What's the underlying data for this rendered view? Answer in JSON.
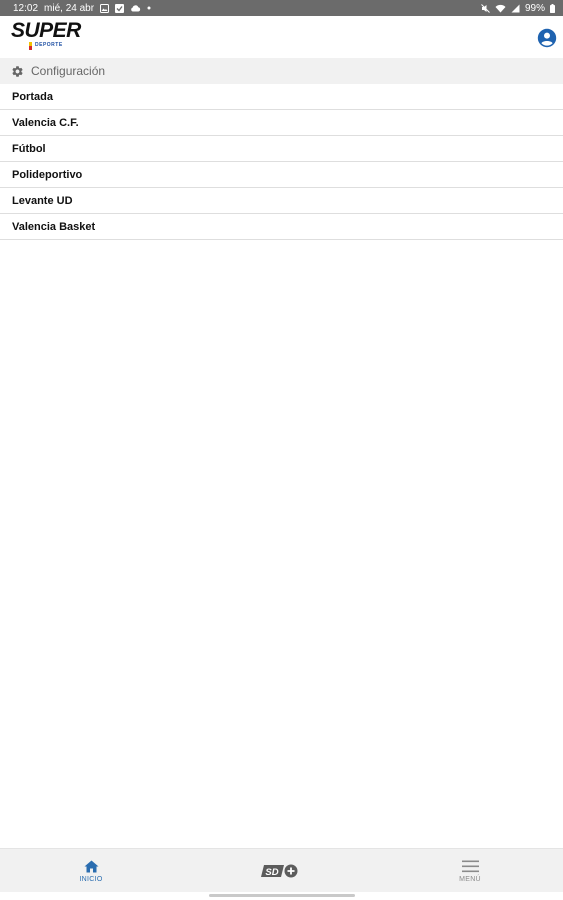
{
  "status_bar": {
    "time": "12:02",
    "date": "mié, 24 abr",
    "battery": "99%"
  },
  "header": {
    "logo_text": "SUPER",
    "logo_subtext": "DEPORTE",
    "account_icon": "account-circle-icon"
  },
  "config": {
    "label": "Configuración",
    "icon": "gear-icon"
  },
  "sections": [
    {
      "label": "Portada"
    },
    {
      "label": "Valencia C.F."
    },
    {
      "label": "Fútbol"
    },
    {
      "label": "Polideportivo"
    },
    {
      "label": "Levante UD"
    },
    {
      "label": "Valencia Basket"
    }
  ],
  "bottom_nav": {
    "home_label": "INICIO",
    "sd_label": "SD+",
    "menu_label": "MENÚ",
    "active_color": "#2a6db0",
    "inactive_color": "#8a8a8a"
  }
}
